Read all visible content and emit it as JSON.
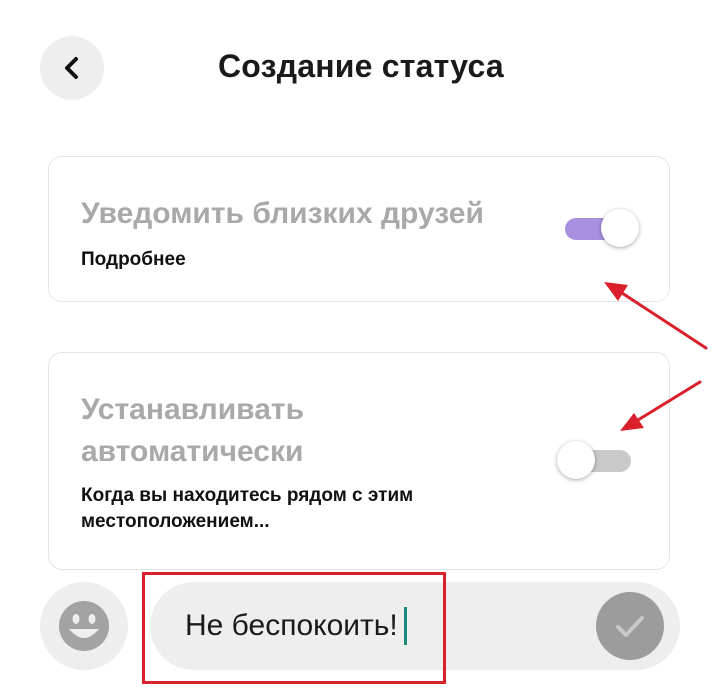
{
  "header": {
    "title": "Создание статуса",
    "back_icon": "chevron-left-icon"
  },
  "settings": [
    {
      "title": "Уведомить близких друзей",
      "subtitle": "Подробнее",
      "toggle_on": true
    },
    {
      "title": "Устанавливать автоматически",
      "subtitle": "Когда вы находитесь рядом с этим местоположением...",
      "toggle_on": false
    }
  ],
  "composer": {
    "emoji_icon": "smiley-face-icon",
    "status_text": "Не беспокоить!",
    "send_icon": "checkmark-icon"
  },
  "colors": {
    "toggle_on_track": "#a98fe0",
    "toggle_off_track": "#c9c9c9",
    "annotation_red": "#d9202b",
    "caret": "#1a8a7a"
  }
}
